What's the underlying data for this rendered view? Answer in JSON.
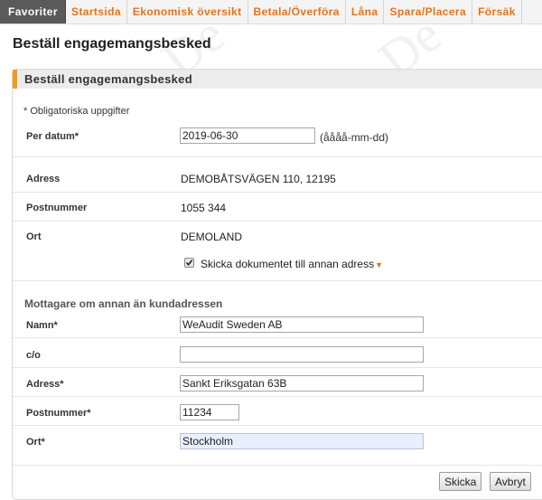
{
  "nav": {
    "tabs": [
      {
        "label": "Favoriter",
        "active": true
      },
      {
        "label": "Startsida"
      },
      {
        "label": "Ekonomisk översikt"
      },
      {
        "label": "Betala/Överföra"
      },
      {
        "label": "Låna"
      },
      {
        "label": "Spara/Placera"
      },
      {
        "label": "Försäk"
      }
    ]
  },
  "page": {
    "title": "Beställ engagemangsbesked",
    "panel_title": "Beställ engagemangsbesked",
    "required_note": "* Obligatoriska uppgifter"
  },
  "form": {
    "date_label": "Per datum*",
    "date_value": "2019-06-30",
    "date_hint": "(åååå-mm-dd)",
    "address_label": "Adress",
    "address_value": "DEMOBÅTSVÄGEN 110, 12195",
    "postal_label": "Postnummer",
    "postal_value": "1055 344",
    "city_label": "Ort",
    "city_value": "DEMOLAND",
    "other_address_checkbox": "Skicka dokumentet till annan adress",
    "other_address_checked": true
  },
  "recipient": {
    "section_title": "Mottagare om annan än kundadressen",
    "name_label": "Namn*",
    "name_value": "WeAudit Sweden AB",
    "co_label": "c/o",
    "co_value": "",
    "address_label": "Adress*",
    "address_value": "Sankt Eriksgatan 63B",
    "postal_label": "Postnummer*",
    "postal_value": "11234",
    "city_label": "Ort*",
    "city_value": "Stockholm"
  },
  "buttons": {
    "send": "Skicka",
    "cancel": "Avbryt"
  },
  "colors": {
    "accent": "#e2731c",
    "panel_stripe": "#f39c19",
    "active_tab_bg": "#5a5a5a"
  }
}
